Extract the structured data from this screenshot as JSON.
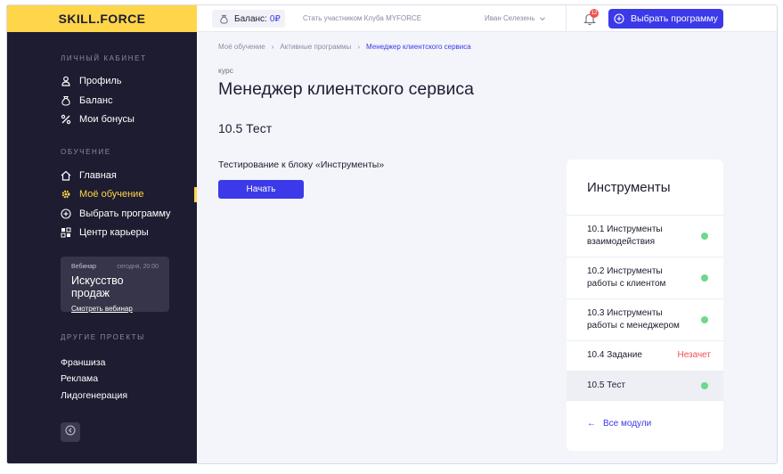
{
  "brand": {
    "logo": "SKILL.FORCE",
    "accent": "#3c39e8",
    "yellow": "#ffd54a",
    "sidebar_bg": "#1d1c30"
  },
  "header": {
    "balance_label": "Баланс:",
    "balance_value": "0₽",
    "club_link": "Стать участником Клуба MYFORCE",
    "user_name": "Иван Селезень",
    "notifications_count": "12",
    "choose_program": "Выбрать программу"
  },
  "sidebar": {
    "section_personal": "Личный кабинет",
    "personal_items": [
      {
        "label": "Профиль",
        "icon": "user-icon"
      },
      {
        "label": "Баланс",
        "icon": "money-bag-icon"
      },
      {
        "label": "Мои бонусы",
        "icon": "percent-icon"
      }
    ],
    "section_learning": "Обучение",
    "learning_items": [
      {
        "label": "Главная",
        "icon": "home-icon"
      },
      {
        "label": "Моё обучение",
        "icon": "gear-icon",
        "active": true
      },
      {
        "label": "Выбрать программу",
        "icon": "plus-circle-icon"
      },
      {
        "label": "Центр карьеры",
        "icon": "career-icon"
      }
    ],
    "webinar": {
      "label": "Вебинар",
      "time": "сегодня, 20:00",
      "title": "Искусство продаж",
      "link": "Смотреть вебинар"
    },
    "section_other": "Другие проекты",
    "other_items": [
      "Франшиза",
      "Реклама",
      "Лидогенерация"
    ]
  },
  "breadcrumb": [
    "Моё обучение",
    "Активные программы",
    "Менеджер клиентского сервиса"
  ],
  "main": {
    "kind": "курс",
    "title": "Менеджер клиентского сервиса",
    "lesson_title": "10.5 Тест",
    "task_description": "Тестирование к блоку «Инструменты»",
    "start_button": "Начать"
  },
  "panel": {
    "title": "Инструменты",
    "modules": [
      {
        "label": "10.1 Инструменты взаимодействия",
        "status": "done"
      },
      {
        "label": "10.2 Инструменты работы с клиентом",
        "status": "done"
      },
      {
        "label": "10.3 Инструменты работы с менеджером",
        "status": "done"
      },
      {
        "label": "10.4 Задание",
        "status": "failed",
        "status_label": "Незачет"
      },
      {
        "label": "10.5 Тест",
        "status": "done",
        "active": true
      }
    ],
    "all_modules": "Все модули"
  }
}
